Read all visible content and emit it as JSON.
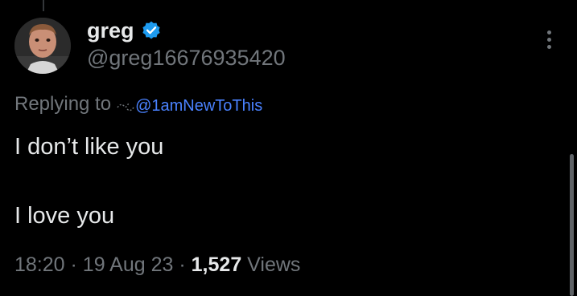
{
  "user": {
    "display_name": "greg",
    "handle": "@greg16676935420",
    "verified": true,
    "verified_color": "#1d9bf0"
  },
  "reply": {
    "label": "Replying to",
    "mention": "@1amNewToThis"
  },
  "tweet": {
    "lines": [
      "I don’t like you",
      "I love you"
    ]
  },
  "meta": {
    "time": "18:20",
    "separator": "·",
    "date": "19 Aug 23",
    "views_count": "1,527",
    "views_label": "Views"
  },
  "icons": {
    "more": "more-vertical-icon",
    "verified": "verified-badge-icon"
  },
  "colors": {
    "background": "#000000",
    "primary_text": "#e7e9ea",
    "secondary_text": "#71767b",
    "link": "#4a82ff"
  }
}
